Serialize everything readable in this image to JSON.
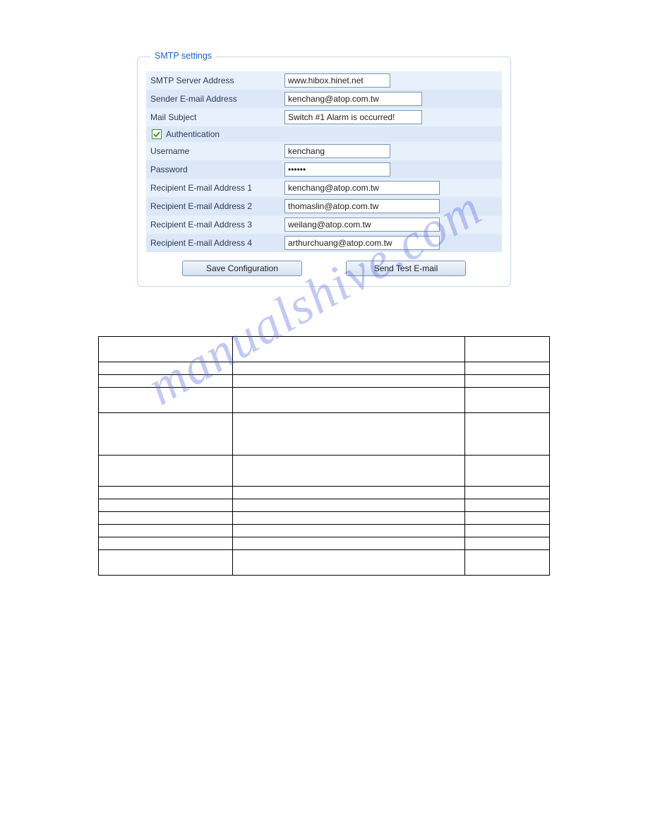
{
  "smtp": {
    "legend": "SMTP settings",
    "rows": {
      "server_label": "SMTP Server Address",
      "server_value": "www.hibox.hinet.net",
      "sender_label": "Sender E-mail Address",
      "sender_value": "kenchang@atop.com.tw",
      "subject_label": "Mail Subject",
      "subject_value": "Switch #1 Alarm is occurred!",
      "auth_label": "Authentication",
      "username_label": "Username",
      "username_value": "kenchang",
      "password_label": "Password",
      "password_value": "••••••",
      "recip1_label": "Recipient E-mail Address 1",
      "recip1_value": "kenchang@atop.com.tw",
      "recip2_label": "Recipient E-mail Address 2",
      "recip2_value": "thomaslin@atop.com.tw",
      "recip3_label": "Recipient E-mail Address 3",
      "recip3_value": "weilang@atop.com.tw",
      "recip4_label": "Recipient E-mail Address 4",
      "recip4_value": "arthurchuang@atop.com.tw"
    },
    "buttons": {
      "save": "Save Configuration",
      "test": "Send Test E-mail"
    }
  },
  "watermark": "manualshive.com"
}
